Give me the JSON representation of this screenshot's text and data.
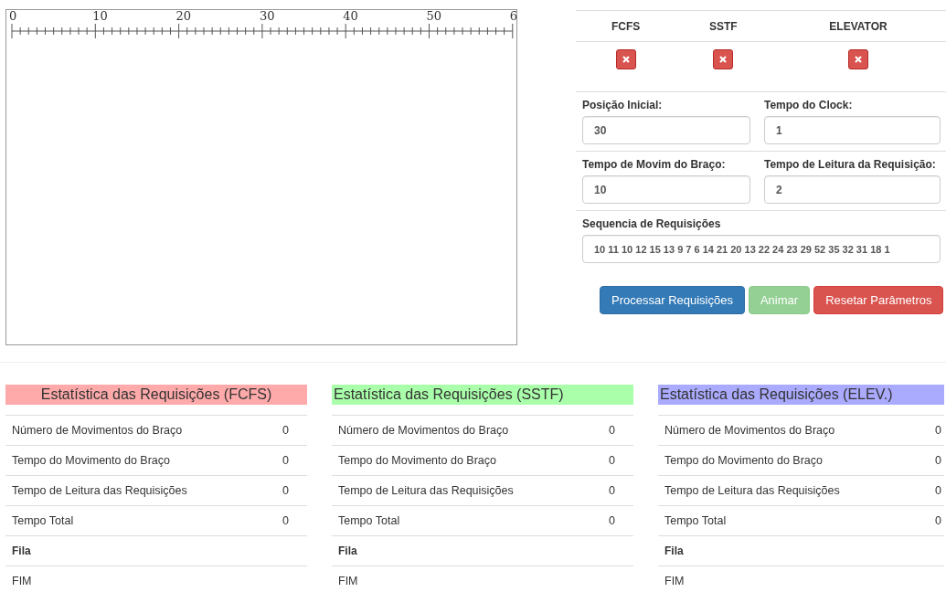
{
  "ruler": {
    "labels": [
      "0",
      "10",
      "20",
      "30",
      "40",
      "50",
      "6"
    ]
  },
  "algorithms": [
    {
      "name": "FCFS"
    },
    {
      "name": "SSTF"
    },
    {
      "name": "ELEVATOR"
    }
  ],
  "fields": [
    {
      "label": "Posição Inicial:",
      "value": "30"
    },
    {
      "label": "Tempo do Clock:",
      "value": "1"
    },
    {
      "label": "Tempo de Movim do Braço:",
      "value": "10"
    },
    {
      "label": "Tempo de Leitura da Requisição:",
      "value": "2"
    }
  ],
  "sequence": {
    "label": "Sequencia de Requisições",
    "value": "10 11 10 12 15 13 9 7 6 14 21 20 13 22 24 23 29 52 35 32 31 18 1"
  },
  "buttons": [
    {
      "label": "Processar Requisições",
      "kind": "primary",
      "disabled": false
    },
    {
      "label": "Animar",
      "kind": "success",
      "disabled": true
    },
    {
      "label": "Resetar Parâmetros",
      "kind": "danger",
      "disabled": false
    }
  ],
  "stats": [
    {
      "title": "Estatística das Requisições (FCFS)",
      "color": "#ffaaaa",
      "rows": [
        {
          "label": "Número de Movimentos do Braço",
          "value": "0"
        },
        {
          "label": "Tempo do Movimento do Braço",
          "value": "0"
        },
        {
          "label": "Tempo de Leitura das Requisições",
          "value": "0"
        },
        {
          "label": "Tempo Total",
          "value": "0"
        }
      ],
      "queue_label": "Fila",
      "end_label": "FIM"
    },
    {
      "title": "Estatística das Requisições (SSTF)",
      "color": "#aaffaa",
      "rows": [
        {
          "label": "Número de Movimentos do Braço",
          "value": "0"
        },
        {
          "label": "Tempo do Movimento do Braço",
          "value": "0"
        },
        {
          "label": "Tempo de Leitura das Requisições",
          "value": "0"
        },
        {
          "label": "Tempo Total",
          "value": "0"
        }
      ],
      "queue_label": "Fila",
      "end_label": "FIM"
    },
    {
      "title": "Estatística das Requisições (ELEV.)",
      "color": "#aaaaff",
      "rows": [
        {
          "label": "Número de Movimentos do Braço",
          "value": "0"
        },
        {
          "label": "Tempo do Movimento do Braço",
          "value": "0"
        },
        {
          "label": "Tempo de Leitura das Requisições",
          "value": "0"
        },
        {
          "label": "Tempo Total",
          "value": "0"
        }
      ],
      "queue_label": "Fila",
      "end_label": "FIM"
    }
  ]
}
